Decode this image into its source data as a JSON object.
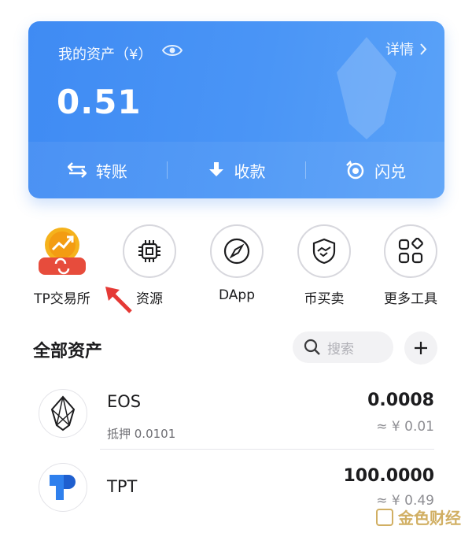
{
  "wallet": {
    "asset_label": "我的资产（¥）",
    "detail_label": "详情",
    "balance": "0.51",
    "actions": [
      {
        "label": "转账",
        "icon": "transfer-icon"
      },
      {
        "label": "收款",
        "icon": "receive-icon"
      },
      {
        "label": "闪兑",
        "icon": "swap-icon"
      }
    ]
  },
  "tools": [
    {
      "label": "TP交易所",
      "icon": "tp-exchange-icon"
    },
    {
      "label": "资源",
      "icon": "chip-icon"
    },
    {
      "label": "DApp",
      "icon": "compass-icon"
    },
    {
      "label": "币买卖",
      "icon": "handshake-icon"
    },
    {
      "label": "更多工具",
      "icon": "grid-icon"
    }
  ],
  "assets_section": {
    "title": "全部资产",
    "search_placeholder": "搜索"
  },
  "assets": [
    {
      "symbol": "EOS",
      "sub": "抵押 0.0101",
      "amount": "0.0008",
      "fiat": "≈ ¥ 0.01",
      "icon": "eos-icon"
    },
    {
      "symbol": "TPT",
      "sub": "",
      "amount": "100.0000",
      "fiat": "≈ ¥ 0.49",
      "icon": "tpt-icon"
    }
  ],
  "watermark": "金色财经",
  "colors": {
    "card": "#4a95f6",
    "annotation_arrow": "#e53935",
    "tp_orange": "#f39c12",
    "tp_red": "#e74c3c",
    "tpt_blue": "#2f80ed"
  }
}
